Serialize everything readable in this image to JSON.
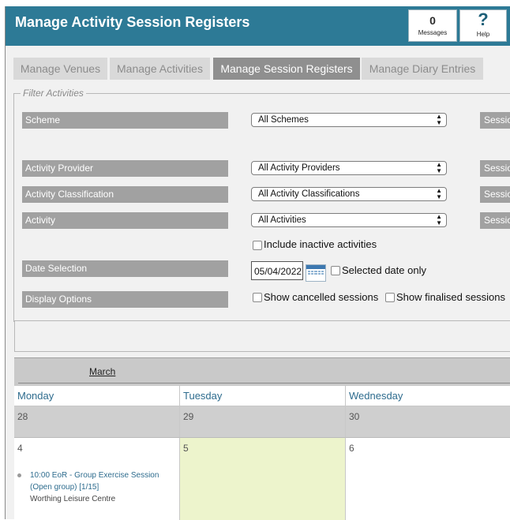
{
  "header": {
    "title": "Manage Activity Session Registers",
    "messages": {
      "count": "0",
      "label": "Messages"
    },
    "help": {
      "symbol": "?",
      "label": "Help"
    }
  },
  "tabs": [
    {
      "label": "Manage Venues",
      "active": false
    },
    {
      "label": "Manage Activities",
      "active": false
    },
    {
      "label": "Manage Session Registers",
      "active": true
    },
    {
      "label": "Manage Diary Entries",
      "active": false
    }
  ],
  "filter": {
    "legend": "Filter Activities",
    "scheme": {
      "label": "Scheme",
      "value": "All Schemes"
    },
    "provider": {
      "label": "Activity Provider",
      "value": "All Activity Providers"
    },
    "classification": {
      "label": "Activity Classification",
      "value": "All Activity Classifications"
    },
    "activity": {
      "label": "Activity",
      "value": "All Activities"
    },
    "include_inactive": "Include inactive activities",
    "date": {
      "label": "Date Selection",
      "value": "05/04/2022",
      "selected_only": "Selected date only"
    },
    "display": {
      "label": "Display Options",
      "show_cancelled": "Show cancelled sessions",
      "show_finalised": "Show finalised sessions"
    },
    "right_labels": [
      "Sessio",
      "Sessio",
      "Sessio",
      "Sessio"
    ]
  },
  "calendar": {
    "month": "March",
    "days": [
      "Monday",
      "Tuesday",
      "Wednesday"
    ],
    "row1": [
      "28",
      "29",
      "30"
    ],
    "row2": [
      "4",
      "5",
      "6"
    ],
    "event": {
      "title": "10:00 EoR - Group Exercise Session (Open group) [1/15]",
      "venue": "Worthing Leisure Centre"
    }
  },
  "colors": {
    "header": "#2d7a96",
    "active_tab": "#8f8f8f",
    "today": "#edf4cc",
    "link": "#2e6c8e"
  }
}
